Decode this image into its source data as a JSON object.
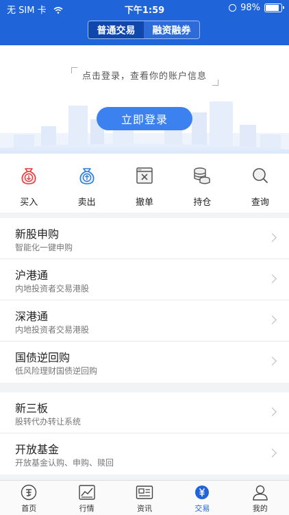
{
  "status_bar": {
    "carrier": "无 SIM 卡",
    "time": "下午1:59",
    "battery": "98%"
  },
  "segment": {
    "tabs": [
      {
        "label": "普通交易",
        "active": true
      },
      {
        "label": "融资融券",
        "active": false
      }
    ]
  },
  "login_banner": {
    "tip": "点击登录，查看你的账户信息",
    "button": "立即登录"
  },
  "quick_actions": [
    {
      "label": "买入",
      "icon": "buy-bag-icon"
    },
    {
      "label": "卖出",
      "icon": "sell-bag-icon"
    },
    {
      "label": "撤单",
      "icon": "cancel-order-icon"
    },
    {
      "label": "持仓",
      "icon": "coins-stack-icon"
    },
    {
      "label": "查询",
      "icon": "search-icon"
    }
  ],
  "services_group1": [
    {
      "title": "新股申购",
      "subtitle": "智能化一键申购"
    },
    {
      "title": "沪港通",
      "subtitle": "内地投资者交易港股"
    },
    {
      "title": "深港通",
      "subtitle": "内地投资者交易港股"
    },
    {
      "title": "国债逆回购",
      "subtitle": "低风险理财国债逆回购"
    }
  ],
  "services_group2": [
    {
      "title": "新三板",
      "subtitle": "股转代办转让系统"
    },
    {
      "title": "开放基金",
      "subtitle": "开放基金认购、申购、赎回"
    }
  ],
  "tab_bar": [
    {
      "label": "首页",
      "icon": "home-icon",
      "active": false
    },
    {
      "label": "行情",
      "icon": "market-chart-icon",
      "active": false
    },
    {
      "label": "资讯",
      "icon": "news-icon",
      "active": false
    },
    {
      "label": "交易",
      "icon": "trade-yuan-icon",
      "active": true
    },
    {
      "label": "我的",
      "icon": "profile-icon",
      "active": false
    }
  ],
  "colors": {
    "brand": "#1f64d8",
    "button": "#3b82f0",
    "buy": "#e23c3c",
    "sell": "#2a7bd8"
  }
}
